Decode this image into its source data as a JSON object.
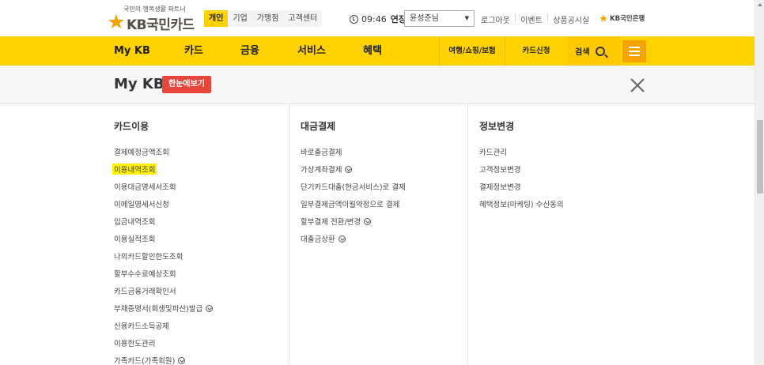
{
  "header": {
    "tagline": "국민의 행복생활 파트너",
    "brand": "KB국민카드",
    "segment_tabs": [
      {
        "label": "개인",
        "active": true
      },
      {
        "label": "기업",
        "active": false
      },
      {
        "label": "가맹점",
        "active": false
      },
      {
        "label": "고객센터",
        "active": false
      }
    ],
    "session_time": "09:46",
    "extend_label": "연장",
    "user_select_value": "윤성준님",
    "util_links": [
      "로그아웃",
      "이벤트",
      "상품공시실"
    ],
    "bank_link": "KB국민은행"
  },
  "nav": {
    "items": [
      "My KB",
      "카드",
      "금융",
      "서비스",
      "혜택"
    ],
    "sub_items": [
      "여행/쇼핑/보험",
      "카드신청"
    ],
    "search_label": "검색",
    "accent_color": "#ffd200"
  },
  "subheader": {
    "title": "My KB",
    "overview_button": "한눈에보기"
  },
  "menu": {
    "columns": [
      {
        "heading": "카드이용",
        "items": [
          {
            "label": "결제예정금액조회",
            "expandable": false,
            "highlighted": false
          },
          {
            "label": "이용내역조회",
            "expandable": false,
            "highlighted": true
          },
          {
            "label": "이용대금명세서조회",
            "expandable": false,
            "highlighted": false
          },
          {
            "label": "이메일명세서신청",
            "expandable": false,
            "highlighted": false
          },
          {
            "label": "입금내역조회",
            "expandable": false,
            "highlighted": false
          },
          {
            "label": "이용실적조회",
            "expandable": false,
            "highlighted": false
          },
          {
            "label": "나의카드할인한도조회",
            "expandable": false,
            "highlighted": false
          },
          {
            "label": "할부수수료예상조회",
            "expandable": false,
            "highlighted": false
          },
          {
            "label": "카드금융거래확인서",
            "expandable": false,
            "highlighted": false
          },
          {
            "label": "부채증명서(회생및파산)발급",
            "expandable": true,
            "highlighted": false
          },
          {
            "label": "신용카드소득공제",
            "expandable": false,
            "highlighted": false
          },
          {
            "label": "이용한도관리",
            "expandable": false,
            "highlighted": false
          },
          {
            "label": "가족카드(가족회원)",
            "expandable": true,
            "highlighted": false
          }
        ]
      },
      {
        "heading": "대금결제",
        "items": [
          {
            "label": "바로출금결제",
            "expandable": false,
            "highlighted": false
          },
          {
            "label": "가상계좌결제",
            "expandable": true,
            "highlighted": false
          },
          {
            "label": "단기카드대출(현금서비스)로 결제",
            "expandable": false,
            "highlighted": false
          },
          {
            "label": "일부결제금액이월약정으로 결제",
            "expandable": false,
            "highlighted": false
          },
          {
            "label": "할부결제 전환/변경",
            "expandable": true,
            "highlighted": false
          },
          {
            "label": "대출금상환",
            "expandable": true,
            "highlighted": false
          }
        ]
      },
      {
        "heading": "정보변경",
        "items": [
          {
            "label": "카드관리",
            "expandable": false,
            "highlighted": false
          },
          {
            "label": "고객정보변경",
            "expandable": false,
            "highlighted": false
          },
          {
            "label": "결제정보변경",
            "expandable": false,
            "highlighted": false
          },
          {
            "label": "혜택정보(마케팅) 수신동의",
            "expandable": false,
            "highlighted": false
          }
        ]
      }
    ]
  }
}
